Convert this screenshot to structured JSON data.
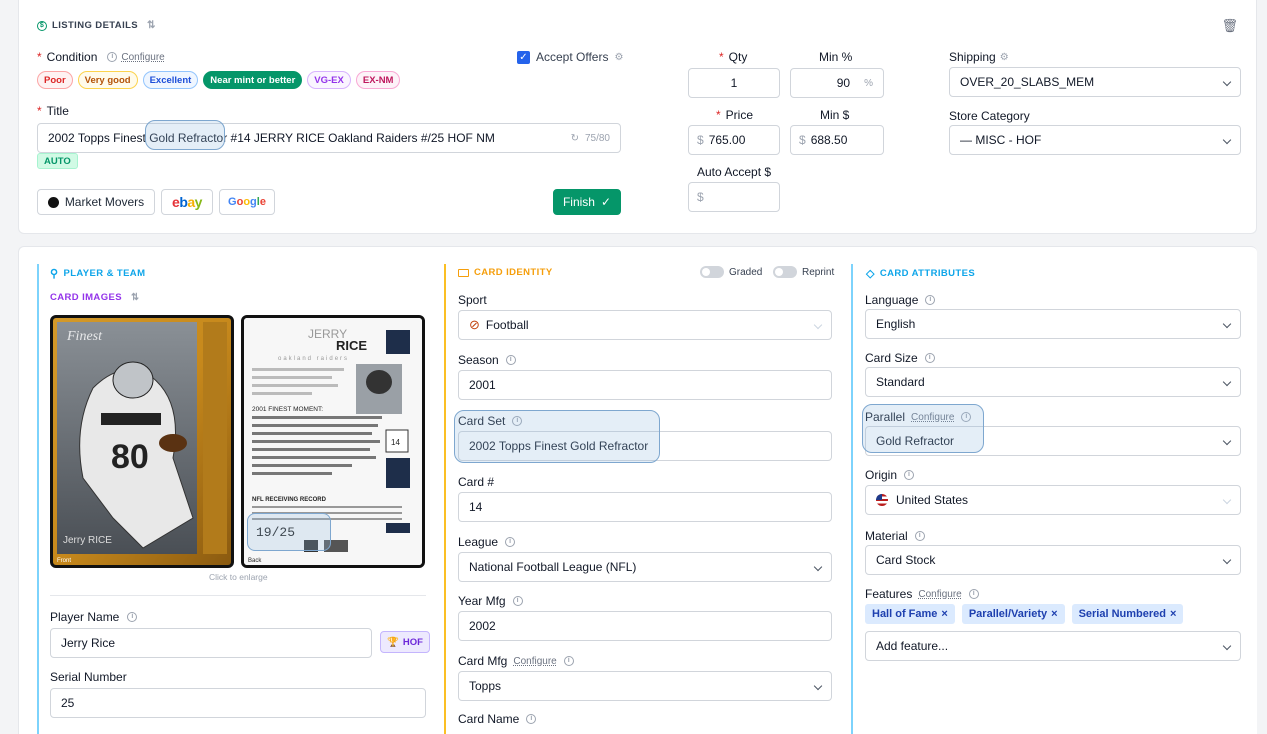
{
  "listing": {
    "section_title": "LISTING DETAILS",
    "condition_label": "Condition",
    "configure": "Configure",
    "condition_chips": [
      "Poor",
      "Very good",
      "Excellent",
      "Near mint or better",
      "VG-EX",
      "EX-NM"
    ],
    "accept_offers": "Accept Offers",
    "title_label": "Title",
    "title_value_pre": "2002 Topps Finest ",
    "title_value_hl": "Gold Refractor",
    "title_value_post": " #14 JERRY RICE Oakland Raiders #/25 HOF NM",
    "title_count": "75/80",
    "auto_badge": "AUTO",
    "market_movers": "Market Movers",
    "ebay": "ebay",
    "google": "Google",
    "finish": "Finish",
    "qty_label": "Qty",
    "qty_value": "1",
    "min_pct_label": "Min %",
    "min_pct_value": "90",
    "pct_sign": "%",
    "price_label": "Price",
    "price_value": "765.00",
    "min_dollar_label": "Min $",
    "min_dollar_value": "688.50",
    "dollar": "$",
    "auto_accept_label": "Auto Accept $",
    "shipping_label": "Shipping",
    "shipping_value": "OVER_20_SLABS_MEM",
    "store_category_label": "Store Category",
    "store_category_value": "— MISC - HOF"
  },
  "player": {
    "section_title": "PLAYER & TEAM",
    "card_images": "CARD IMAGES",
    "front": "Front",
    "back": "Back",
    "click_to_enlarge": "Click to enlarge",
    "player_name_label": "Player Name",
    "player_name_value": "Jerry Rice",
    "hof_badge": "HOF",
    "serial_label": "Serial Number",
    "serial_value": "25",
    "back_first": "JERRY",
    "back_last": "RICE",
    "back_team": "oakland raiders",
    "serial_stamp": "19/25",
    "front_name": "Jerry RICE",
    "jersey": "80",
    "back_number": "14",
    "finest_moment": "2001 FINEST MOMENT:",
    "receiving_record": "NFL RECEIVING RECORD"
  },
  "identity": {
    "section_title": "CARD IDENTITY",
    "graded": "Graded",
    "reprint": "Reprint",
    "sport_label": "Sport",
    "sport_value": "Football",
    "season_label": "Season",
    "season_value": "2001",
    "card_set_label": "Card Set",
    "card_set_value": "2002 Topps Finest Gold Refractor",
    "card_num_label": "Card #",
    "card_num_value": "14",
    "league_label": "League",
    "league_value": "National Football League (NFL)",
    "year_mfg_label": "Year Mfg",
    "year_mfg_value": "2002",
    "card_mfg_label": "Card Mfg",
    "card_mfg_value": "Topps",
    "card_name_label": "Card Name"
  },
  "attributes": {
    "section_title": "CARD ATTRIBUTES",
    "language_label": "Language",
    "language_value": "English",
    "card_size_label": "Card Size",
    "card_size_value": "Standard",
    "parallel_label": "Parallel",
    "parallel_value": "Gold Refractor",
    "origin_label": "Origin",
    "origin_value": "United States",
    "material_label": "Material",
    "material_value": "Card Stock",
    "features_label": "Features",
    "features": [
      "Hall of Fame",
      "Parallel/Variety",
      "Serial Numbered"
    ],
    "add_feature_placeholder": "Add feature..."
  },
  "colors": {
    "accent_green": "#059669",
    "accent_blue": "#2563eb",
    "section_blue": "#0ea5e9",
    "section_orange": "#f59e0b",
    "section_purple": "#9333ea"
  }
}
